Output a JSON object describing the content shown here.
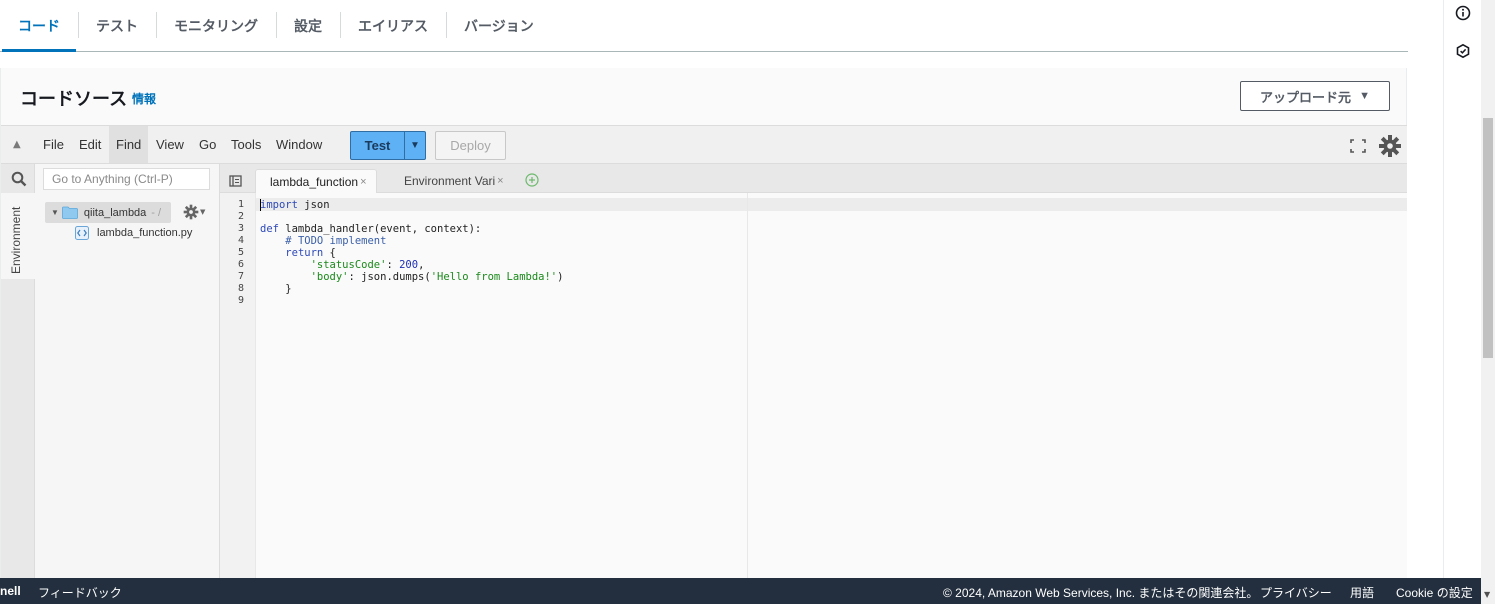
{
  "tabs": [
    {
      "label": "コード"
    },
    {
      "label": "テスト"
    },
    {
      "label": "モニタリング"
    },
    {
      "label": "設定"
    },
    {
      "label": "エイリアス"
    },
    {
      "label": "バージョン"
    }
  ],
  "panel": {
    "title": "コードソース",
    "info_link": "情報",
    "upload_label": "アップロード元"
  },
  "ide": {
    "menu": [
      "File",
      "Edit",
      "Find",
      "View",
      "Go",
      "Tools",
      "Window"
    ],
    "test_label": "Test",
    "deploy_label": "Deploy",
    "goto_placeholder": "Go to Anything (Ctrl-P)",
    "side_tab": "Environment",
    "folder_name": "qiita_lambda",
    "folder_path": "- /",
    "file_name": "lambda_function.py",
    "editor_tabs": [
      "lambda_function",
      "Environment Vari"
    ],
    "lines": [
      "import json",
      "",
      "def lambda_handler(event, context):",
      "    # TODO implement",
      "    return {",
      "        'statusCode': 200,",
      "        'body': json.dumps('Hello from Lambda!')",
      "    }",
      ""
    ]
  },
  "footer": {
    "shell": "nell",
    "feedback": "フィードバック",
    "copyright": "© 2024, Amazon Web Services, Inc. またはその関連会社。",
    "privacy": "プライバシー",
    "terms": "用語",
    "cookie": "Cookie の設定"
  },
  "colors": {
    "accent": "#0073bb",
    "test_button": "#5fb1f5",
    "footer_bg": "#232f3e"
  }
}
